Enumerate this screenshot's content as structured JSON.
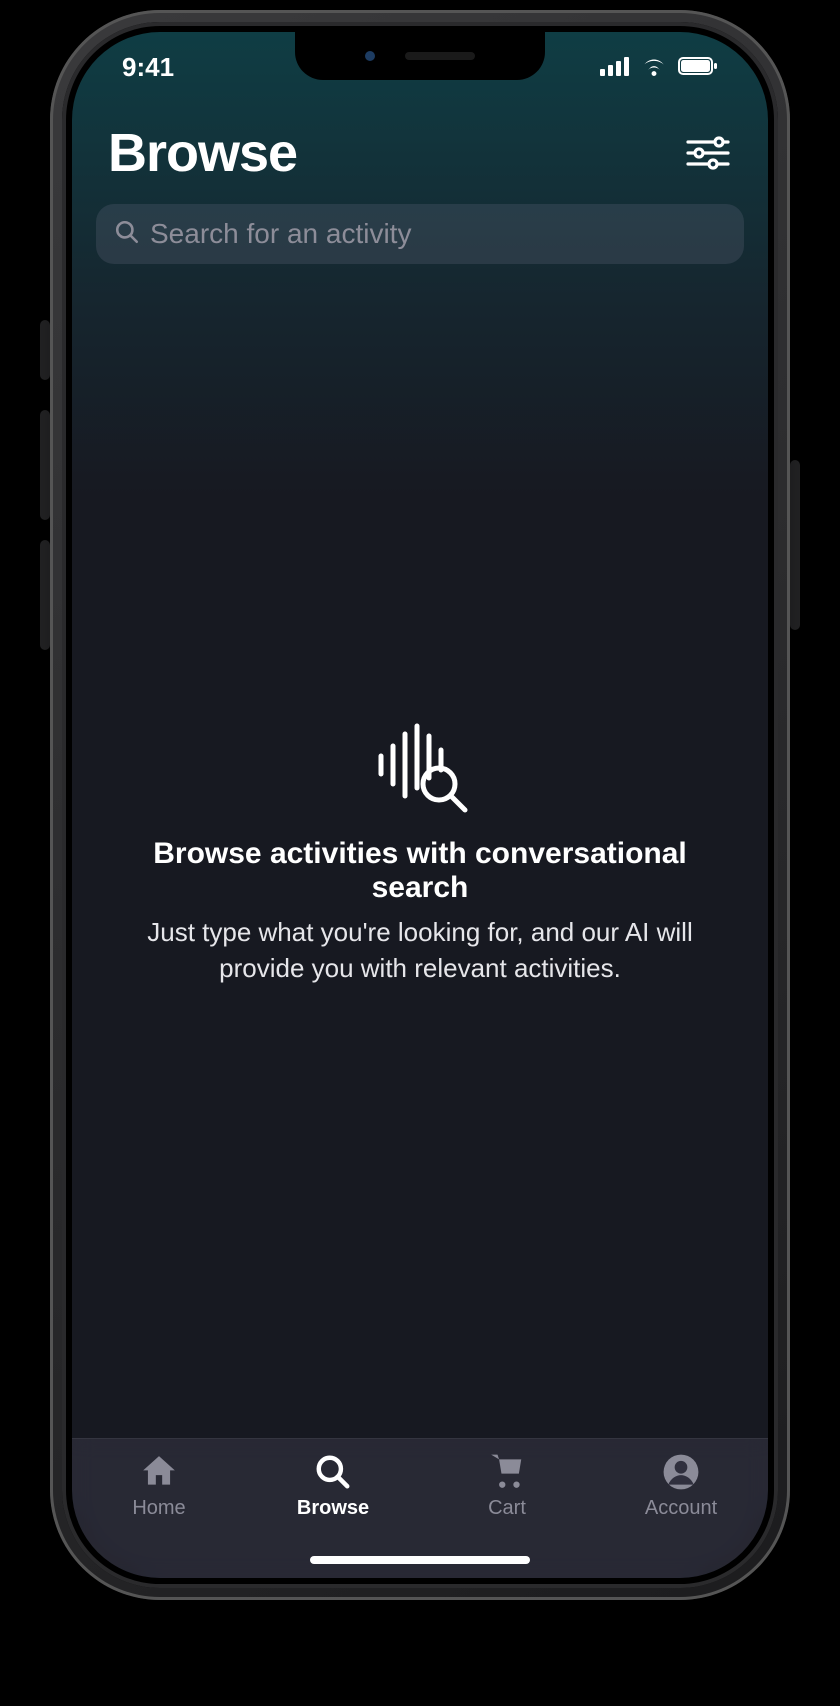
{
  "status": {
    "time": "9:41"
  },
  "header": {
    "title": "Browse"
  },
  "search": {
    "placeholder": "Search for an activity"
  },
  "empty": {
    "title": "Browse activities with conversational search",
    "subtitle": "Just type what you're looking for, and our AI will provide you with relevant activities."
  },
  "tabs": {
    "home": {
      "label": "Home"
    },
    "browse": {
      "label": "Browse"
    },
    "cart": {
      "label": "Cart"
    },
    "account": {
      "label": "Account"
    }
  }
}
